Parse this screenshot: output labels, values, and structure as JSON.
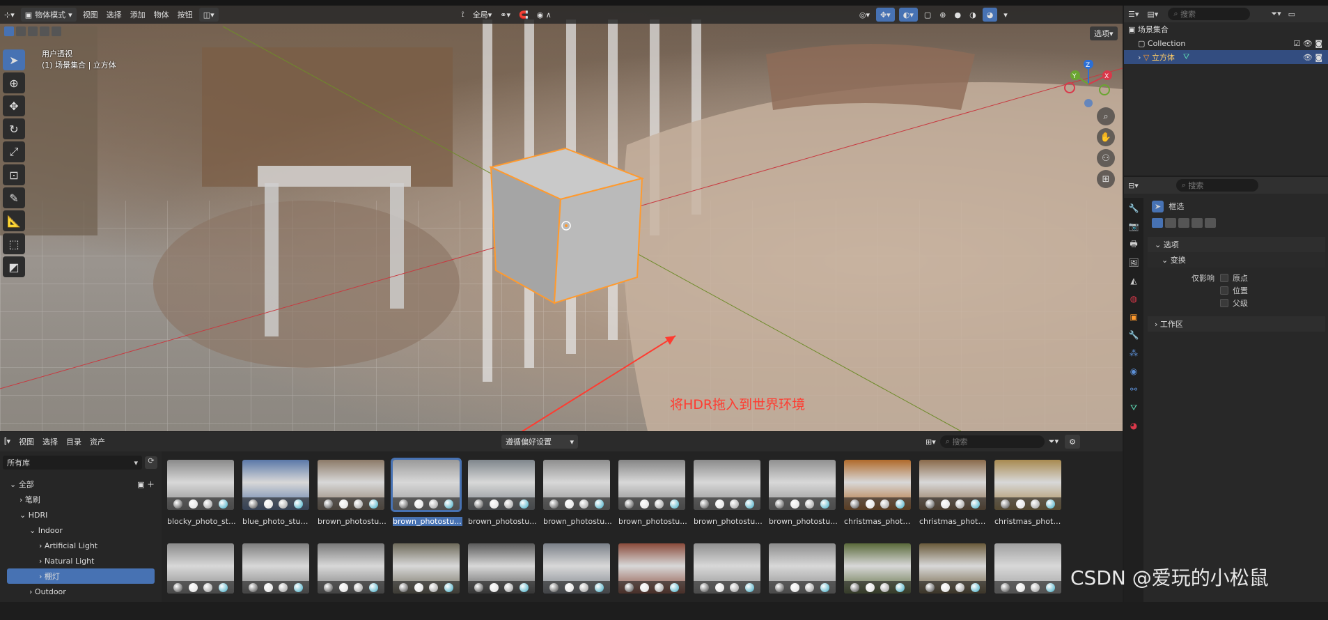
{
  "viewport": {
    "header": {
      "mode_label": "物体模式",
      "menus": [
        "视图",
        "选择",
        "添加",
        "物体",
        "按钮"
      ],
      "transform_orientation": "全局",
      "options_label": "选项"
    },
    "info_line1": "用户透视",
    "info_line2": "(1) 场景集合 | 立方体",
    "gizmo_axes": {
      "x": "X",
      "y": "Y",
      "z": "Z"
    },
    "annotation": "将HDR拖入到世界环境"
  },
  "outliner": {
    "search_placeholder": "搜索",
    "scene_collection": "场景集合",
    "collection": "Collection",
    "object": "立方体"
  },
  "properties": {
    "search_placeholder": "搜索",
    "tool_name": "框选",
    "panel_options": "选项",
    "subpanel_transform": "变换",
    "affect_only_label": "仅影响",
    "affect_origin": "原点",
    "affect_location": "位置",
    "affect_parents": "父级",
    "panel_workspace": "工作区"
  },
  "asset_browser": {
    "menus": [
      "视图",
      "选择",
      "目录",
      "资产"
    ],
    "import_method": "遵循偏好设置",
    "search_placeholder": "搜索",
    "library": "所有库",
    "tree": [
      "全部",
      "笔刷",
      "HDRI",
      "Indoor",
      "Artificial Light",
      "Natural Light",
      "棚灯",
      "Outdoor"
    ],
    "row1": [
      "blocky_photo_st...",
      "blue_photo_studio",
      "brown_photostu...",
      "brown_photostu...",
      "brown_photostu...",
      "brown_photostu...",
      "brown_photostu...",
      "brown_photostu...",
      "brown_photostu...",
      "christmas_photo...",
      "christmas_photo...",
      "christmas_photo..."
    ],
    "selected_index": 3
  },
  "watermark": "CSDN @爱玩的小松鼠",
  "colors": {
    "accent": "#4772b3",
    "selection_outline": "#ff9a2e",
    "annotation": "#ff3b30"
  }
}
